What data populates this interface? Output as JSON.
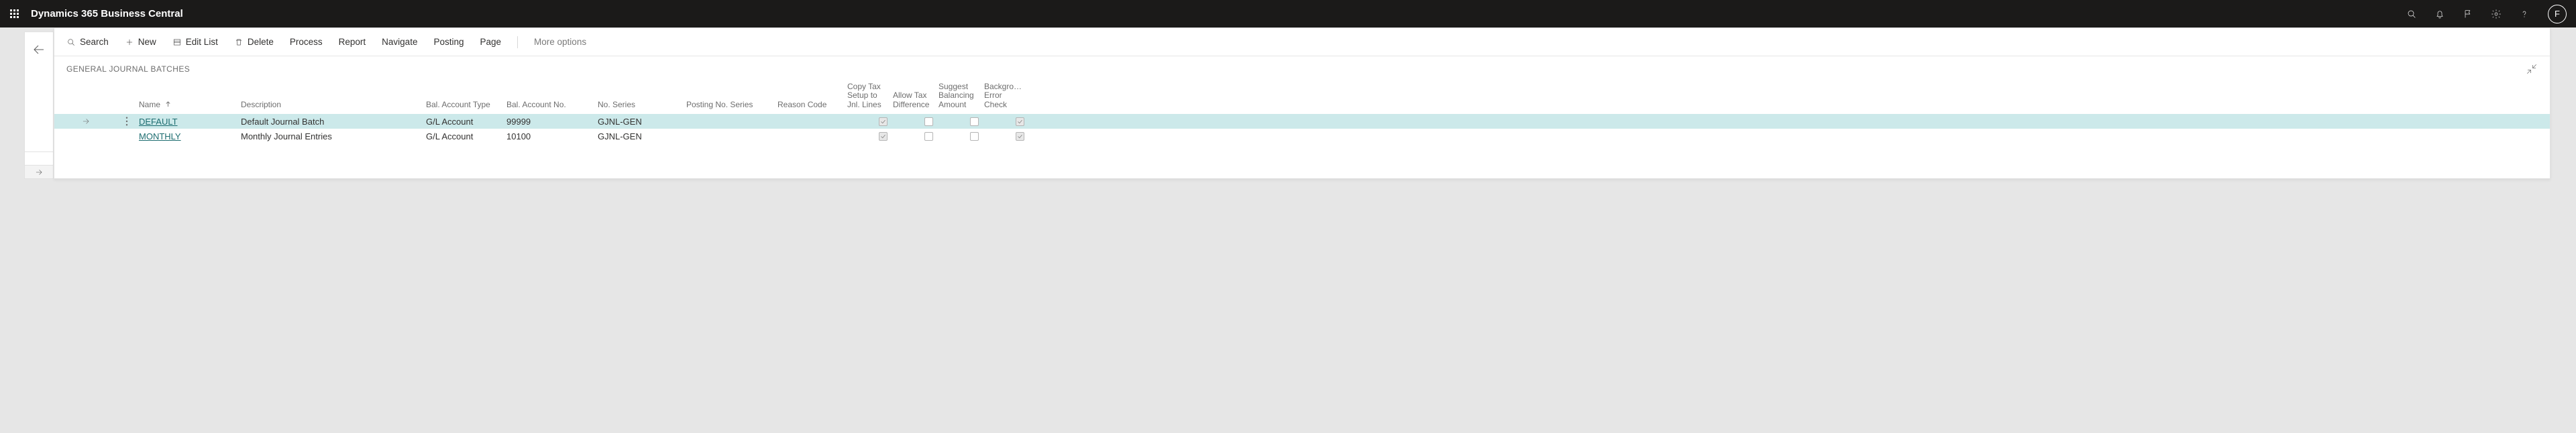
{
  "appTitle": "Dynamics 365 Business Central",
  "avatarInitial": "F",
  "commands": {
    "search": "Search",
    "new": "New",
    "edit": "Edit List",
    "delete": "Delete",
    "process": "Process",
    "report": "Report",
    "navigate": "Navigate",
    "posting": "Posting",
    "page": "Page",
    "more": "More options"
  },
  "pageTitle": "GENERAL JOURNAL BATCHES",
  "columns": {
    "name": "Name",
    "description": "Description",
    "balAccountType": "Bal. Account Type",
    "balAccountNo": "Bal. Account No.",
    "noSeries": "No. Series",
    "postingNoSeries": "Posting No. Series",
    "reasonCode": "Reason Code",
    "copyTax": "Copy Tax Setup to Jnl. Lines",
    "allowTax": "Allow Tax Difference",
    "suggestBal": "Suggest Balancing Amount",
    "bgError": "Background Error Check"
  },
  "rows": [
    {
      "selected": true,
      "name": "DEFAULT",
      "description": "Default Journal Batch",
      "balAccountType": "G/L Account",
      "balAccountNo": "99999",
      "noSeries": "GJNL-GEN",
      "postingNoSeries": "",
      "reasonCode": "",
      "copyTax": true,
      "allowTax": false,
      "suggestBal": false,
      "bgError": true
    },
    {
      "selected": false,
      "name": "MONTHLY",
      "description": "Monthly Journal Entries",
      "balAccountType": "G/L Account",
      "balAccountNo": "10100",
      "noSeries": "GJNL-GEN",
      "postingNoSeries": "",
      "reasonCode": "",
      "copyTax": true,
      "allowTax": false,
      "suggestBal": false,
      "bgError": true
    }
  ]
}
